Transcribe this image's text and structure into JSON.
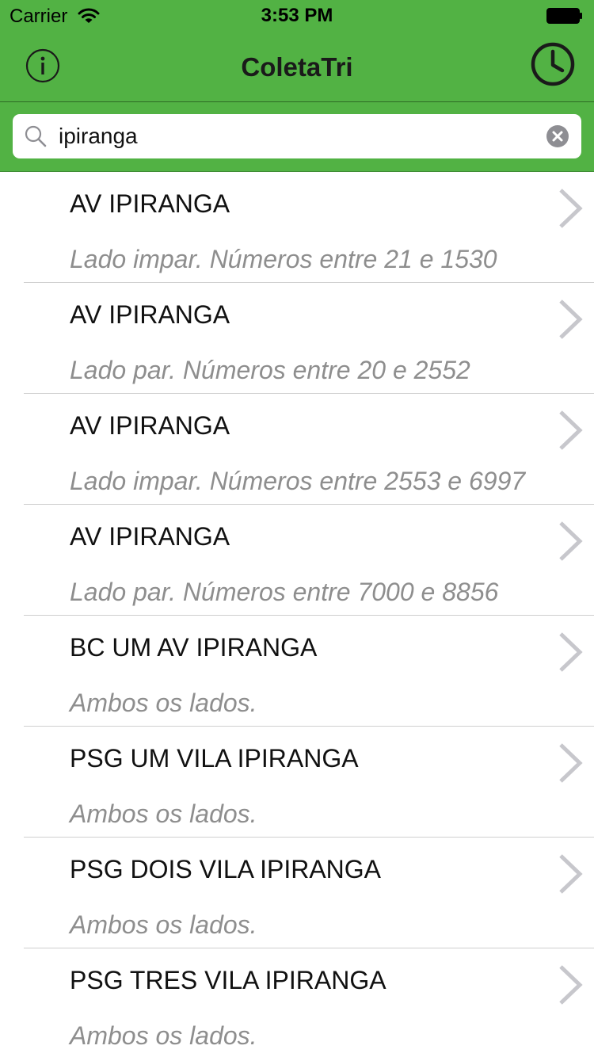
{
  "status_bar": {
    "carrier": "Carrier",
    "time": "3:53 PM"
  },
  "nav": {
    "title": "ColetaTri",
    "left_icon": "info-icon",
    "right_icon": "clock-icon"
  },
  "search": {
    "value": "ipiranga",
    "placeholder": ""
  },
  "colors": {
    "accent": "#52b244",
    "subtitle": "#8e8e8e",
    "chevron": "#c7c7cc"
  },
  "results": [
    {
      "title": "AV IPIRANGA",
      "subtitle": "Lado impar. Números entre 21 e 1530"
    },
    {
      "title": "AV IPIRANGA",
      "subtitle": "Lado par. Números entre 20 e 2552"
    },
    {
      "title": "AV IPIRANGA",
      "subtitle": "Lado impar. Números entre 2553 e 6997"
    },
    {
      "title": "AV IPIRANGA",
      "subtitle": "Lado par. Números entre 7000 e 8856"
    },
    {
      "title": "BC UM AV IPIRANGA",
      "subtitle": "Ambos os lados."
    },
    {
      "title": "PSG UM VILA IPIRANGA",
      "subtitle": "Ambos os lados."
    },
    {
      "title": "PSG DOIS VILA IPIRANGA",
      "subtitle": "Ambos os lados."
    },
    {
      "title": "PSG TRES VILA IPIRANGA",
      "subtitle": "Ambos os lados."
    }
  ]
}
